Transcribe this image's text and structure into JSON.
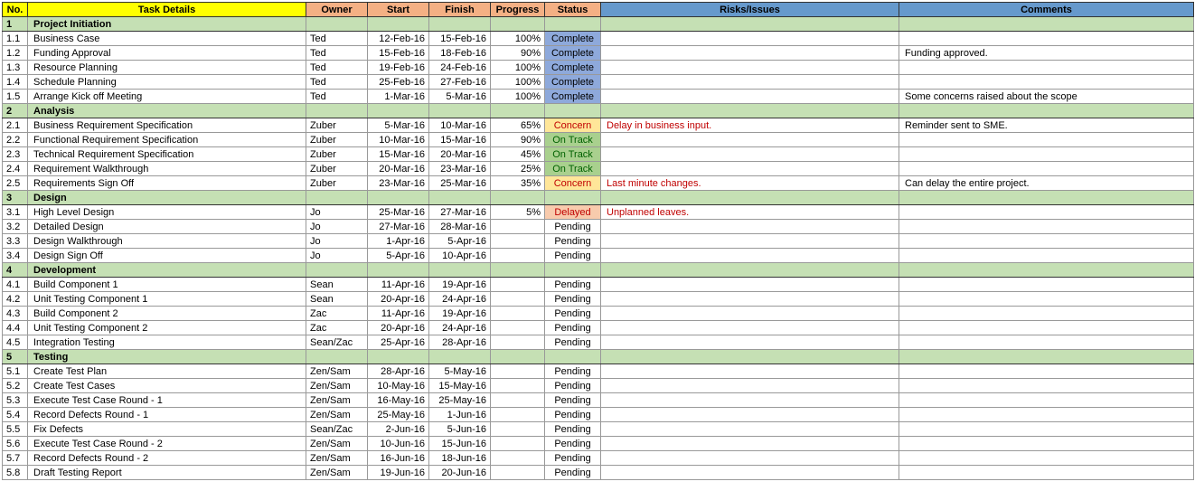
{
  "headers": {
    "no": "No.",
    "task": "Task Details",
    "owner": "Owner",
    "start": "Start",
    "finish": "Finish",
    "progress": "Progress",
    "status": "Status",
    "risks": "Risks/Issues",
    "comments": "Comments"
  },
  "status_styles": {
    "Complete": "st-complete",
    "Concern": "st-concern",
    "On Track": "st-ontrack",
    "Delayed": "st-delayed",
    "Pending": "st-pending"
  },
  "rows": [
    {
      "type": "section",
      "no": "1",
      "task": "Project Initiation"
    },
    {
      "type": "task",
      "no": "1.1",
      "task": "Business Case",
      "owner": "Ted",
      "start": "12-Feb-16",
      "finish": "15-Feb-16",
      "progress": "100%",
      "status": "Complete",
      "risks": "",
      "comments": ""
    },
    {
      "type": "task",
      "no": "1.2",
      "task": "Funding Approval",
      "owner": "Ted",
      "start": "15-Feb-16",
      "finish": "18-Feb-16",
      "progress": "90%",
      "status": "Complete",
      "risks": "",
      "comments": "Funding approved."
    },
    {
      "type": "task",
      "no": "1.3",
      "task": "Resource Planning",
      "owner": "Ted",
      "start": "19-Feb-16",
      "finish": "24-Feb-16",
      "progress": "100%",
      "status": "Complete",
      "risks": "",
      "comments": ""
    },
    {
      "type": "task",
      "no": "1.4",
      "task": "Schedule Planning",
      "owner": "Ted",
      "start": "25-Feb-16",
      "finish": "27-Feb-16",
      "progress": "100%",
      "status": "Complete",
      "risks": "",
      "comments": ""
    },
    {
      "type": "task",
      "no": "1.5",
      "task": "Arrange Kick off Meeting",
      "owner": "Ted",
      "start": "1-Mar-16",
      "finish": "5-Mar-16",
      "progress": "100%",
      "status": "Complete",
      "risks": "",
      "comments": "Some concerns raised about the scope"
    },
    {
      "type": "section",
      "no": "2",
      "task": "Analysis"
    },
    {
      "type": "task",
      "no": "2.1",
      "task": "Business Requirement Specification",
      "owner": "Zuber",
      "start": "5-Mar-16",
      "finish": "10-Mar-16",
      "progress": "65%",
      "status": "Concern",
      "risks": "Delay in business input.",
      "risks_red": true,
      "comments": "Reminder sent to SME."
    },
    {
      "type": "task",
      "no": "2.2",
      "task": "Functional Requirement Specification",
      "owner": "Zuber",
      "start": "10-Mar-16",
      "finish": "15-Mar-16",
      "progress": "90%",
      "status": "On Track",
      "risks": "",
      "comments": ""
    },
    {
      "type": "task",
      "no": "2.3",
      "task": "Technical Requirement Specification",
      "owner": "Zuber",
      "start": "15-Mar-16",
      "finish": "20-Mar-16",
      "progress": "45%",
      "status": "On Track",
      "risks": "",
      "comments": ""
    },
    {
      "type": "task",
      "no": "2.4",
      "task": "Requirement Walkthrough",
      "owner": "Zuber",
      "start": "20-Mar-16",
      "finish": "23-Mar-16",
      "progress": "25%",
      "status": "On Track",
      "risks": "",
      "comments": ""
    },
    {
      "type": "task",
      "no": "2.5",
      "task": "Requirements Sign Off",
      "owner": "Zuber",
      "start": "23-Mar-16",
      "finish": "25-Mar-16",
      "progress": "35%",
      "status": "Concern",
      "risks": "Last minute changes.",
      "risks_red": true,
      "comments": "Can delay the entire project."
    },
    {
      "type": "section",
      "no": "3",
      "task": "Design"
    },
    {
      "type": "task",
      "no": "3.1",
      "task": "High Level Design",
      "owner": "Jo",
      "start": "25-Mar-16",
      "finish": "27-Mar-16",
      "progress": "5%",
      "status": "Delayed",
      "risks": "Unplanned leaves.",
      "risks_red": true,
      "comments": ""
    },
    {
      "type": "task",
      "no": "3.2",
      "task": "Detailed Design",
      "owner": "Jo",
      "start": "27-Mar-16",
      "finish": "28-Mar-16",
      "progress": "",
      "status": "Pending",
      "risks": "",
      "comments": ""
    },
    {
      "type": "task",
      "no": "3.3",
      "task": "Design Walkthrough",
      "owner": "Jo",
      "start": "1-Apr-16",
      "finish": "5-Apr-16",
      "progress": "",
      "status": "Pending",
      "risks": "",
      "comments": ""
    },
    {
      "type": "task",
      "no": "3.4",
      "task": "Design Sign Off",
      "owner": "Jo",
      "start": "5-Apr-16",
      "finish": "10-Apr-16",
      "progress": "",
      "status": "Pending",
      "risks": "",
      "comments": ""
    },
    {
      "type": "section",
      "no": "4",
      "task": "Development"
    },
    {
      "type": "task",
      "no": "4.1",
      "task": "Build Component 1",
      "owner": "Sean",
      "start": "11-Apr-16",
      "finish": "19-Apr-16",
      "progress": "",
      "status": "Pending",
      "risks": "",
      "comments": ""
    },
    {
      "type": "task",
      "no": "4.2",
      "task": "Unit Testing Component 1",
      "owner": "Sean",
      "start": "20-Apr-16",
      "finish": "24-Apr-16",
      "progress": "",
      "status": "Pending",
      "risks": "",
      "comments": ""
    },
    {
      "type": "task",
      "no": "4.3",
      "task": "Build Component 2",
      "owner": "Zac",
      "start": "11-Apr-16",
      "finish": "19-Apr-16",
      "progress": "",
      "status": "Pending",
      "risks": "",
      "comments": ""
    },
    {
      "type": "task",
      "no": "4.4",
      "task": "Unit Testing Component 2",
      "owner": "Zac",
      "start": "20-Apr-16",
      "finish": "24-Apr-16",
      "progress": "",
      "status": "Pending",
      "risks": "",
      "comments": ""
    },
    {
      "type": "task",
      "no": "4.5",
      "task": "Integration Testing",
      "owner": "Sean/Zac",
      "start": "25-Apr-16",
      "finish": "28-Apr-16",
      "progress": "",
      "status": "Pending",
      "risks": "",
      "comments": ""
    },
    {
      "type": "section",
      "no": "5",
      "task": "Testing"
    },
    {
      "type": "task",
      "no": "5.1",
      "task": "Create Test Plan",
      "owner": "Zen/Sam",
      "start": "28-Apr-16",
      "finish": "5-May-16",
      "progress": "",
      "status": "Pending",
      "risks": "",
      "comments": ""
    },
    {
      "type": "task",
      "no": "5.2",
      "task": "Create Test Cases",
      "owner": "Zen/Sam",
      "start": "10-May-16",
      "finish": "15-May-16",
      "progress": "",
      "status": "Pending",
      "risks": "",
      "comments": ""
    },
    {
      "type": "task",
      "no": "5.3",
      "task": "Execute Test Case Round - 1",
      "owner": "Zen/Sam",
      "start": "16-May-16",
      "finish": "25-May-16",
      "progress": "",
      "status": "Pending",
      "risks": "",
      "comments": ""
    },
    {
      "type": "task",
      "no": "5.4",
      "task": "Record Defects Round - 1",
      "owner": "Zen/Sam",
      "start": "25-May-16",
      "finish": "1-Jun-16",
      "progress": "",
      "status": "Pending",
      "risks": "",
      "comments": ""
    },
    {
      "type": "task",
      "no": "5.5",
      "task": "Fix Defects",
      "owner": "Sean/Zac",
      "start": "2-Jun-16",
      "finish": "5-Jun-16",
      "progress": "",
      "status": "Pending",
      "risks": "",
      "comments": ""
    },
    {
      "type": "task",
      "no": "5.6",
      "task": "Execute Test Case Round - 2",
      "owner": "Zen/Sam",
      "start": "10-Jun-16",
      "finish": "15-Jun-16",
      "progress": "",
      "status": "Pending",
      "risks": "",
      "comments": ""
    },
    {
      "type": "task",
      "no": "5.7",
      "task": "Record Defects Round - 2",
      "owner": "Zen/Sam",
      "start": "16-Jun-16",
      "finish": "18-Jun-16",
      "progress": "",
      "status": "Pending",
      "risks": "",
      "comments": ""
    },
    {
      "type": "task",
      "no": "5.8",
      "task": "Draft Testing Report",
      "owner": "Zen/Sam",
      "start": "19-Jun-16",
      "finish": "20-Jun-16",
      "progress": "",
      "status": "Pending",
      "risks": "",
      "comments": ""
    }
  ]
}
